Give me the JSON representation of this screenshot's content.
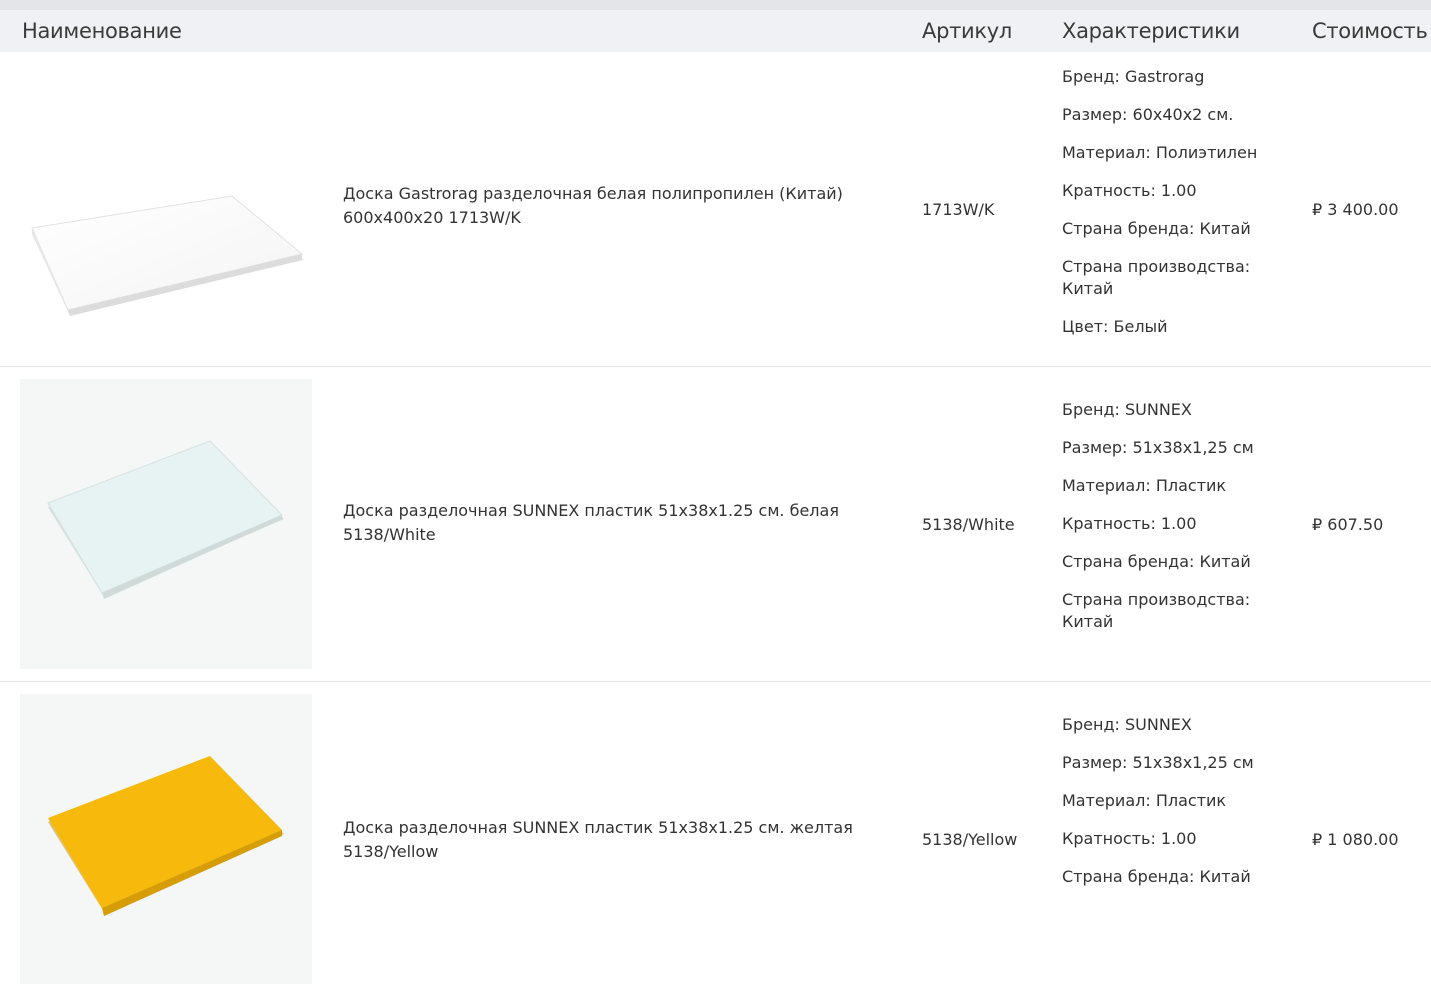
{
  "header": {
    "name": "Наименование",
    "sku": "Артикул",
    "specs": "Характеристики",
    "price": "Стоимость"
  },
  "products": [
    {
      "name": "Доска Gastrorag разделочная белая полипропилен (Китай) 600x400x20 1713W/K",
      "sku": "1713W/K",
      "price": "₽ 3 400.00",
      "board_color": "#ffffff",
      "specs": [
        "Бренд: Gastrorag",
        "Размер: 60х40х2 см.",
        "Материал: Полиэтилен",
        "Кратность: 1.00",
        "Страна бренда: Китай",
        "Страна производства: Китай",
        "Цвет: Белый"
      ]
    },
    {
      "name": "Доска разделочная SUNNEX пластик 51x38x1.25 см. белая 5138/White",
      "sku": "5138/White",
      "price": "₽ 607.50",
      "board_color": "#e6f3f2",
      "specs": [
        "Бренд: SUNNEX",
        "Размер: 51x38x1,25 см",
        "Материал: Пластик",
        "Кратность: 1.00",
        "Страна бренда: Китай",
        "Страна производства: Китай"
      ]
    },
    {
      "name": "Доска разделочная SUNNEX пластик 51x38x1.25 см. желтая 5138/Yellow",
      "sku": "5138/Yellow",
      "price": "₽ 1 080.00",
      "board_color": "#f6b90c",
      "specs": [
        "Бренд: SUNNEX",
        "Размер: 51x38x1,25 см",
        "Материал: Пластик",
        "Кратность: 1.00",
        "Страна бренда: Китай"
      ]
    }
  ]
}
